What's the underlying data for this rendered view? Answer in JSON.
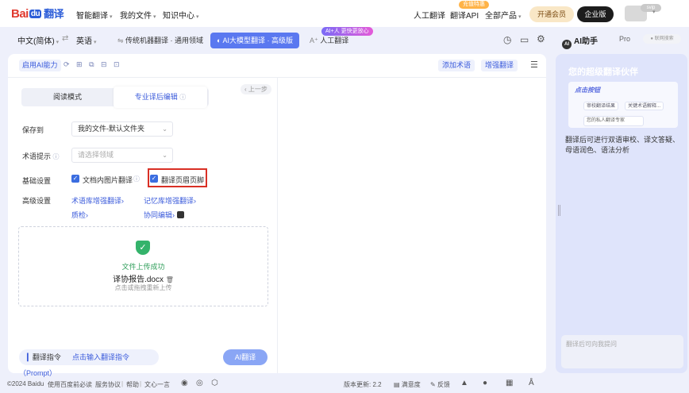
{
  "brand": {
    "bai": "Bai",
    "du": "du",
    "fy": "翻译"
  },
  "topnav": {
    "items": [
      {
        "label": "智能翻译"
      },
      {
        "label": "我的文件"
      },
      {
        "label": "知识中心"
      }
    ],
    "right": {
      "human": "人工翻译",
      "api": "翻译API",
      "promo_tag": "充值特惠",
      "products": "全部产品",
      "member": "开通会员",
      "enterprise": "企业版",
      "vip": "svip"
    }
  },
  "langbar": {
    "source": "中文(简体)",
    "swap": "⇄",
    "target": "英语",
    "mode_traditional": "传统机器翻译 · 通用领域",
    "mode_ai": "AI大模型翻译 · 高级版",
    "mode_human": "人工翻译",
    "ai_tag": "AI+人 更快更放心"
  },
  "toolbar": {
    "ai_toggle": "启用AI能力",
    "icons": "⟳ ⊞ ⧉ ⊟ ⊡",
    "add_term": "添加术语",
    "enhance": "增强翻译",
    "menu": "☰"
  },
  "panel": {
    "tab_read": "阅读模式",
    "tab_edit": "专业译后编辑",
    "prev": "‹ 上一步",
    "save_to_label": "保存到",
    "save_to_value": "我的文件-默认文件夹",
    "term_label": "术语提示",
    "term_placeholder": "请选择领域",
    "basic_label": "基础设置",
    "opt_images": "文档内图片翻译",
    "opt_header": "翻译页眉页脚",
    "adv_label": "高级设置",
    "adv_links": [
      "术语库增强翻译",
      "记忆库增强翻译",
      "质检",
      "协同编辑"
    ],
    "upload": {
      "status": "文件上传成功",
      "filename": "译协报告.docx",
      "hint": "点击或拖拽重新上传"
    },
    "prompt_label": "翻译指令",
    "prompt_placeholder": "点击输入翻译指令（Prompt）",
    "translate_btn": "AI翻译"
  },
  "assistant": {
    "title": "AI助手",
    "pro": "Pro",
    "net": "联网搜索",
    "headline": "您的超级翻译伙伴",
    "hero_title": "点击按钮",
    "chip1": "审校翻译结果",
    "chip2": "关键术语解释...",
    "hero_input": "您的私人翻译专家",
    "desc": "翻译后可进行双语审校、译文答疑、母语润色、语法分析",
    "ask_placeholder": "翻译后可向我提问"
  },
  "footer": {
    "copyright": "©2024 Baidu",
    "links": [
      "使用百度前必读",
      "服务协议",
      "帮助",
      "文心一言"
    ],
    "version": "版本更新: 2.2",
    "survey": "满意度",
    "feedback": "反馈"
  }
}
